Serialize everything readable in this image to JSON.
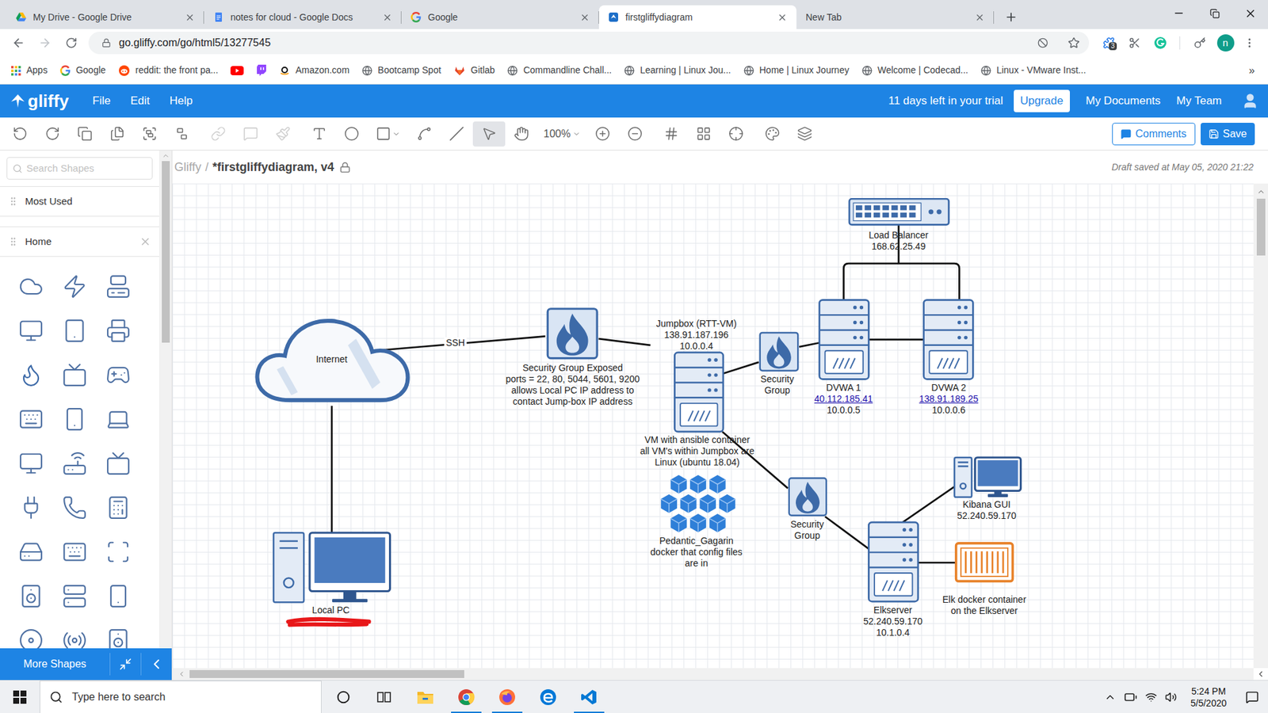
{
  "browser": {
    "tabs": [
      {
        "label": "My Drive - Google Drive",
        "selected": false
      },
      {
        "label": "notes for cloud - Google Docs",
        "selected": false
      },
      {
        "label": "Google",
        "selected": false
      },
      {
        "label": "firstgliffydiagram",
        "selected": true
      },
      {
        "label": "New Tab",
        "selected": false
      }
    ],
    "url": "go.gliffy.com/go/html5/13277545",
    "extension_badge": "3",
    "profile_initial": "n",
    "bookmarks": [
      "Apps",
      "Google",
      "reddit: the front pa...",
      "Amazon.com",
      "Bootcamp Spot",
      "Gitlab",
      "Commandline Chall...",
      "Learning | Linux Jou...",
      "Home | Linux Journey",
      "Welcome | Codecad...",
      "Linux - VMware Inst..."
    ],
    "bookmarks_overflow": "»"
  },
  "app": {
    "logo": "gliffy",
    "menu": [
      "File",
      "Edit",
      "Help"
    ],
    "trial": "11 days left in your trial",
    "upgrade": "Upgrade",
    "nav": [
      "My Documents",
      "My Team"
    ]
  },
  "toolbar": {
    "tools": [
      {
        "selected": false,
        "disabled": false
      },
      {
        "selected": false,
        "disabled": false
      },
      {
        "selected": false,
        "disabled": false
      },
      {
        "selected": false,
        "disabled": false
      },
      {
        "selected": false,
        "disabled": false
      },
      {
        "selected": false,
        "disabled": false
      },
      {
        "selected": false,
        "disabled": true
      },
      {
        "selected": false,
        "disabled": true
      },
      {
        "selected": false,
        "disabled": true
      },
      {
        "selected": false,
        "disabled": false
      },
      {
        "selected": false,
        "disabled": false
      },
      {
        "selected": false,
        "disabled": false
      },
      {
        "selected": false,
        "disabled": false
      },
      {
        "selected": false,
        "disabled": false
      },
      {
        "selected": true,
        "disabled": false
      },
      {
        "selected": false,
        "disabled": false
      },
      {
        "selected": false,
        "disabled": false
      },
      {
        "selected": false,
        "disabled": false
      },
      {
        "selected": false,
        "disabled": false
      },
      {
        "selected": false,
        "disabled": false
      },
      {
        "selected": false,
        "disabled": false
      },
      {
        "selected": false,
        "disabled": false
      },
      {
        "selected": false,
        "disabled": false
      }
    ],
    "zoom": "100%",
    "comments": "Comments",
    "save": "Save"
  },
  "sidebar": {
    "search_placeholder": "Search Shapes",
    "sections": [
      {
        "label": "Most Used",
        "closable": false
      },
      {
        "label": "Home",
        "closable": true
      }
    ],
    "more_shapes": "More Shapes"
  },
  "document": {
    "root": "Gliffy",
    "separator": "/",
    "title": "*firstgliffydiagram, v4",
    "status": "Draft saved at May 05, 2020 21:22"
  },
  "diagram": {
    "edge_label": "SSH",
    "nodes": [
      {
        "kind": "cloud",
        "redacted": false,
        "lines": [
          {
            "text": "Internet",
            "link": false
          }
        ]
      },
      {
        "kind": "firewall",
        "redacted": false,
        "lines": [
          {
            "text": "Security Group Exposed",
            "link": false
          },
          {
            "text": "ports = 22, 80, 5044, 5601, 9200",
            "link": false
          },
          {
            "text": "allows Local PC IP address to",
            "link": false
          },
          {
            "text": "contact Jump-box IP address",
            "link": false
          }
        ]
      },
      {
        "kind": "server",
        "redacted": false,
        "lines": [
          {
            "text": "Jumpbox (RTT-VM)",
            "link": false
          },
          {
            "text": "138.91.187.196",
            "link": false
          },
          {
            "text": "10.0.0.4",
            "link": false
          }
        ]
      },
      {
        "kind": "text",
        "redacted": false,
        "lines": [
          {
            "text": "VM with ansible container",
            "link": false
          },
          {
            "text": "all VM's within Jumpbox are",
            "link": false
          },
          {
            "text": "Linux (ubuntu 18.04)",
            "link": false
          }
        ]
      },
      {
        "kind": "docker",
        "redacted": false,
        "lines": [
          {
            "text": "Pedantic_Gagarin",
            "link": false
          },
          {
            "text": "docker that config files",
            "link": false
          },
          {
            "text": "are in",
            "link": false
          }
        ]
      },
      {
        "kind": "firewall",
        "redacted": false,
        "lines": [
          {
            "text": "Security",
            "link": false
          },
          {
            "text": "Group",
            "link": false
          }
        ]
      },
      {
        "kind": "server",
        "redacted": false,
        "lines": [
          {
            "text": "DVWA 1",
            "link": false
          },
          {
            "text": "40.112.185.41",
            "link": true
          },
          {
            "text": "10.0.0.5",
            "link": false
          }
        ]
      },
      {
        "kind": "server",
        "redacted": false,
        "lines": [
          {
            "text": "DVWA 2",
            "link": false
          },
          {
            "text": "138.91.189.25",
            "link": true
          },
          {
            "text": "10.0.0.6",
            "link": false
          }
        ]
      },
      {
        "kind": "switch",
        "redacted": false,
        "lines": [
          {
            "text": "Load Balancer",
            "link": false
          },
          {
            "text": "168.62.25.49",
            "link": false
          }
        ]
      },
      {
        "kind": "firewall",
        "redacted": false,
        "lines": [
          {
            "text": "Security",
            "link": false
          },
          {
            "text": "Group",
            "link": false
          }
        ]
      },
      {
        "kind": "server",
        "redacted": false,
        "lines": [
          {
            "text": "Elkserver",
            "link": false
          },
          {
            "text": "52.240.59.170",
            "link": false
          },
          {
            "text": "10.1.0.4",
            "link": false
          }
        ]
      },
      {
        "kind": "desktop",
        "redacted": false,
        "lines": [
          {
            "text": "Kibana GUI",
            "link": false
          },
          {
            "text": "52.240.59.170",
            "link": false
          }
        ]
      },
      {
        "kind": "container",
        "redacted": false,
        "lines": [
          {
            "text": "Elk docker container",
            "link": false
          },
          {
            "text": "on the Elkserver",
            "link": false
          }
        ]
      },
      {
        "kind": "desktop",
        "redacted": true,
        "lines": [
          {
            "text": "Local PC",
            "link": false
          }
        ]
      }
    ]
  },
  "taskbar": {
    "search_placeholder": "Type here to search",
    "pinned_apps": [
      {
        "running": false
      },
      {
        "running": true
      },
      {
        "running": true
      },
      {
        "running": false
      },
      {
        "running": true
      }
    ],
    "time": "5:24 PM",
    "date": "5/5/2020"
  }
}
